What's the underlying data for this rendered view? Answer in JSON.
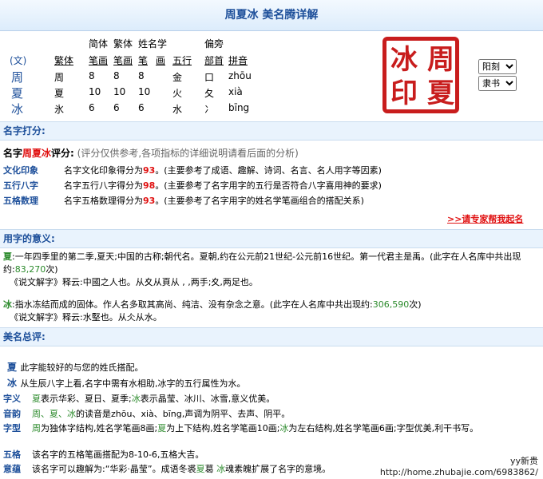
{
  "title": "周夏冰  美名腾详解",
  "char_table": {
    "hdr1": {
      "simp": "简体",
      "trad": "繁体",
      "name": "姓名学",
      "pian": "偏旁"
    },
    "hdr2": {
      "col0": "(文)",
      "trad": "繁体",
      "simp": "笔画",
      "trad2": "笔画",
      "name1": "笔",
      "name2": "画",
      "wuxing": "五行",
      "pian": "部首",
      "pinyin": "拼音"
    },
    "rows": [
      {
        "char": "周",
        "trad": "周",
        "c1": "8",
        "c2": "8",
        "c3": "8",
        "wx": "金",
        "bs": "口",
        "py": "zhōu"
      },
      {
        "char": "夏",
        "trad": "夏",
        "c1": "10",
        "c2": "10",
        "c3": "10",
        "wx": "火",
        "bs": "夂",
        "py": "xià"
      },
      {
        "char": "冰",
        "trad": "氷",
        "c1": "6",
        "c2": "6",
        "c3": "6",
        "wx": "水",
        "bs": "冫",
        "py": "bīng"
      }
    ]
  },
  "seal": {
    "chars": [
      "周",
      "冰",
      "夏",
      "印"
    ]
  },
  "selects": {
    "font": "阳刻",
    "style": "隶书"
  },
  "score": {
    "section": "名字打分:",
    "intro_a": "名字",
    "intro_name": "周夏冰",
    "intro_b": "评分:",
    "intro_note": "(评分仅供参考,各项指标的详细说明请看后面的分析)",
    "rows": [
      {
        "label": "文化印象",
        "text_a": "名字文化印象得分为",
        "score": "93",
        "text_b": "。(主要参考了成语、趣解、诗词、名言、名人用字等因素)"
      },
      {
        "label": "五行八字",
        "text_a": "名字五行八字得分为",
        "score": "98",
        "text_b": "。(主要参考了名字用字的五行是否符合八字喜用神的要求)"
      },
      {
        "label": "五格数理",
        "text_a": "名字五格数理得分为",
        "score": "93",
        "text_b": "。(主要参考了名字用字的姓名学笔画组合的搭配关系)"
      }
    ],
    "link": ">>请专家帮我起名"
  },
  "meaning": {
    "section": "用字的意义:",
    "xia": {
      "char": "夏",
      "text": ":一年四季里的第二季,夏天;中国的古称;朝代名。夏朝,约在公元前21世纪-公元前16世纪。第一代君主是禹。(此字在人名库中共出现约:",
      "count": "83,270",
      "tail": "次)",
      "shuowen": "《说文解字》释云:中國之人也。从夊从頁从   ,   ,两手;夊,两足也。"
    },
    "bing": {
      "char": "冰",
      "text": ":指水冻结而成的固体。作人名多取其高尚、纯洁、没有杂念之意。(此字在人名库中共出现约:",
      "count": "306,590",
      "tail": "次)",
      "shuowen": "《说文解字》释云:水堅也。从仌从水。"
    }
  },
  "summary": {
    "section": "美名总评:",
    "l1_char": "夏",
    "l1": "此字能较好的与您的姓氏搭配。",
    "l2_char": "冰",
    "l2": "从生辰八字上看,名字中需有水相助,冰字的五行属性为水。",
    "rows": [
      {
        "label": "字义",
        "parts": [
          {
            "t": "夏",
            "c": "green"
          },
          {
            "t": "表示华彩、夏日、夏季;"
          },
          {
            "t": "冰",
            "c": "green"
          },
          {
            "t": "表示晶莹、冰川、冰雪,意义优美。"
          }
        ]
      },
      {
        "label": "音韵",
        "parts": [
          {
            "t": "周、夏、冰",
            "c": "green"
          },
          {
            "t": "的读音是zhōu、xià、bīng,声调为阴平、去声、阴平。"
          }
        ]
      },
      {
        "label": "字型",
        "parts": [
          {
            "t": "周",
            "c": "green"
          },
          {
            "t": "为独体字结构,姓名学笔画8画;"
          },
          {
            "t": "夏",
            "c": "green"
          },
          {
            "t": "为上下结构,姓名学笔画10画;"
          },
          {
            "t": "冰",
            "c": "green"
          },
          {
            "t": "为左右结构,姓名学笔画6画;字型优美,利干书写。"
          }
        ]
      },
      {
        "label": "五格",
        "parts": [
          {
            "t": "该名字的五格笔画搭配为8-10-6,五格大吉。"
          }
        ]
      },
      {
        "label": "意蕴",
        "parts": [
          {
            "t": "该名字可以趣解为:“华彩·晶莹”。成语冬裘"
          },
          {
            "t": "夏",
            "c": "green"
          },
          {
            "t": "葛 "
          },
          {
            "t": "冰",
            "c": "green"
          },
          {
            "t": "魂素魄扩展了名字的意境。"
          }
        ]
      }
    ]
  },
  "watermark": {
    "author": "yy新贵",
    "url": "http://home.zhubajie.com/6983862/"
  }
}
